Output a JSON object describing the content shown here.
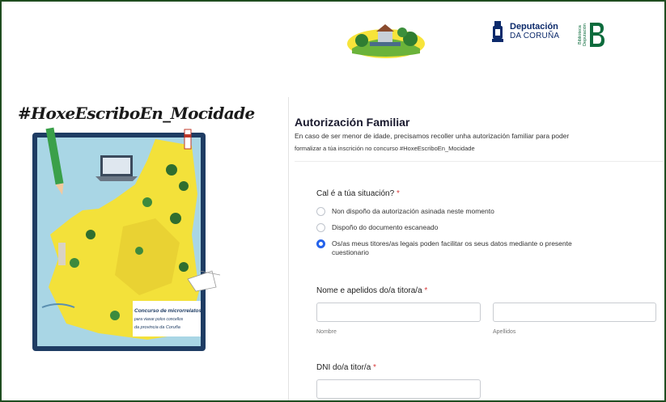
{
  "header": {
    "deputacion_line1": "Deputación",
    "deputacion_line2": "DA CORUÑA",
    "biblioteca_text": "Biblioteca Deputación"
  },
  "left_panel": {
    "hashtag": "#HoxeEscriboEn_Mocidade",
    "card_line1": "Concurso de microrrelatos",
    "card_line2": "para viaxar polos concellos",
    "card_line3": "da provincia da Coruña"
  },
  "form": {
    "title": "Autorización Familiar",
    "description_line1": "En caso de ser menor de idade, precisamos recoller unha autorización familiar para poder",
    "description_line2": "formalizar a túa inscrición no concurso #HoxeEscriboEn_Mocidade",
    "situation": {
      "label": "Cal é a túa situación?",
      "required_mark": "*",
      "options": [
        {
          "label": "Non dispoño da autorización asinada neste momento",
          "selected": false
        },
        {
          "label": "Dispoño do documento escaneado",
          "selected": false
        },
        {
          "label": "Os/as meus titores/as legais poden facilitar os seus datos mediante o presente",
          "label_line2": "cuestionario",
          "selected": true
        }
      ]
    },
    "guardian_name": {
      "label": "Nome e apelidos do/a titora/a",
      "required_mark": "*",
      "first_name_value": "",
      "first_name_sublabel": "Nombre",
      "last_name_value": "",
      "last_name_sublabel": "Apellidos"
    },
    "guardian_dni": {
      "label": "DNI do/a titor/a",
      "required_mark": "*",
      "value": ""
    }
  },
  "colors": {
    "frame_border": "#1f4d20",
    "accent_radio": "#2563eb",
    "required": "#d93a3a",
    "map_yellow": "#f3e13a",
    "sea_blue": "#a9d6e5"
  },
  "icons": [
    "illustration-logo",
    "deputacion-crest-icon",
    "biblioteca-b-icon",
    "pencil-icon",
    "laptop-icon",
    "lighthouse-icon"
  ]
}
